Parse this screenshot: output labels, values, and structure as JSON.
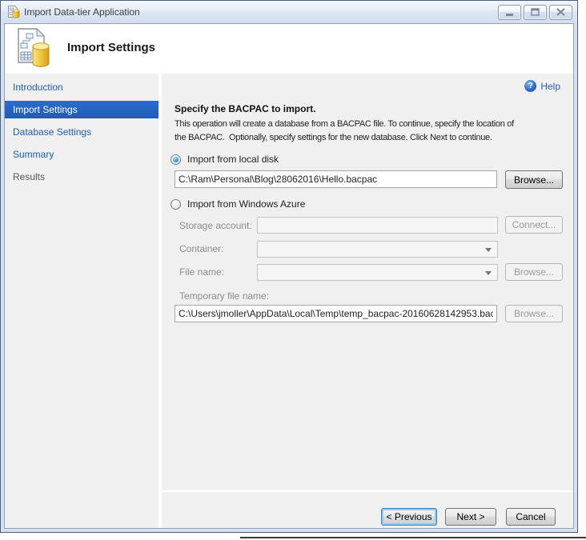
{
  "window": {
    "title": "Import Data-tier Application",
    "icons": {
      "app": "datatier-app-icon",
      "minimize": "minimize-icon",
      "maximize": "maximize-icon",
      "close": "close-icon"
    }
  },
  "header": {
    "title": "Import Settings",
    "icon": "import-wizard-icon"
  },
  "sidebar": {
    "items": [
      {
        "label": "Introduction",
        "state": "link"
      },
      {
        "label": "Import Settings",
        "state": "selected"
      },
      {
        "label": "Database Settings",
        "state": "link"
      },
      {
        "label": "Summary",
        "state": "link"
      },
      {
        "label": "Results",
        "state": "disabled"
      }
    ]
  },
  "content": {
    "help_label": "Help",
    "help_icon": "help-icon",
    "heading": "Specify the BACPAC to import.",
    "description_line1": "This operation will create a database from a BACPAC file. To continue, specify the location of",
    "description_line2": "the BACPAC.  Optionally, specify settings for the new database. Click Next to continue.",
    "local_disk": {
      "radio_label": "Import from local disk",
      "checked": true,
      "path_value": "C:\\Ram\\Personal\\Blog\\28062016\\Hello.bacpac",
      "browse_label": "Browse..."
    },
    "windows_azure": {
      "radio_label": "Import from Windows Azure",
      "checked": false,
      "storage_account_label": "Storage account:",
      "storage_account_value": "",
      "connect_label": "Connect...",
      "container_label": "Container:",
      "container_value": "",
      "file_name_label": "File name:",
      "file_name_value": "",
      "browse_label": "Browse..."
    },
    "temporary": {
      "label": "Temporary file name:",
      "value": "C:\\Users\\jmoller\\AppData\\Local\\Temp\\temp_bacpac-20160628142953.bac",
      "browse_label": "Browse..."
    }
  },
  "footer": {
    "previous_label": "< Previous",
    "next_label": "Next >",
    "cancel_label": "Cancel"
  },
  "colors": {
    "nav_selected_bg": "#2261c2",
    "nav_link": "#1b5cbe",
    "nav_disabled": "#565656",
    "help_link": "#2b5bc8",
    "frame": "#d4e1f1",
    "body_bg": "#f0f0f0",
    "selected_text": "#ffffff"
  }
}
